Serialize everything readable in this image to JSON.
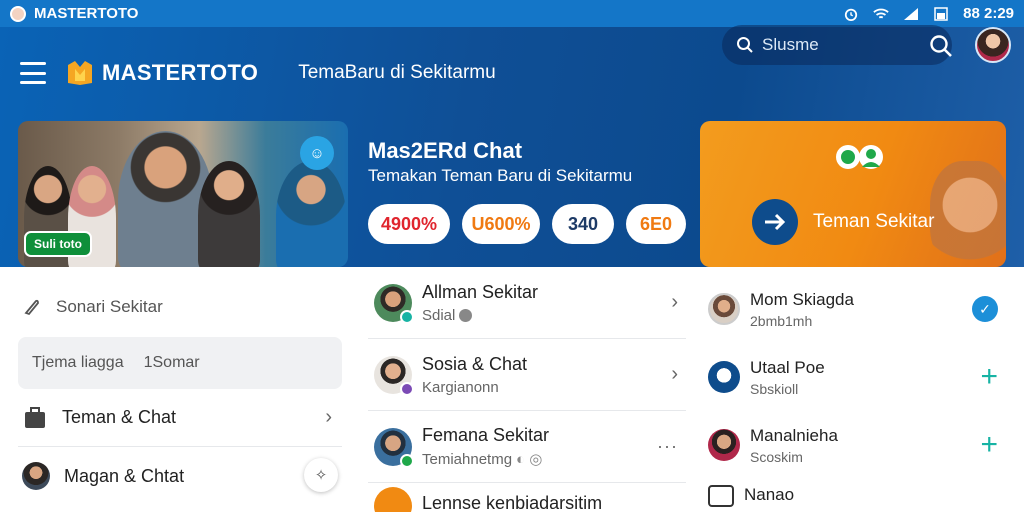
{
  "status_bar": {
    "app_name": "MASTERTOTO",
    "time": "88 2:29",
    "icons": [
      "alarm-icon",
      "wifi-icon",
      "signal-icon",
      "battery-icon"
    ]
  },
  "header": {
    "brand": "MASTERTOTO",
    "tagline": "TemaBaru di Sekitarmu",
    "search_placeholder": "Slusme"
  },
  "promo": {
    "photo_badge": "Suli toto",
    "title": "Mas2ERd Chat",
    "subtitle": "Temakan Teman Baru di Sekitarmu",
    "stats": [
      {
        "label": "4900%",
        "color": "#e0252e"
      },
      {
        "label": "U600%",
        "color": "#f07a12"
      },
      {
        "label": "340",
        "color": "#1d3a66"
      },
      {
        "label": "6E0",
        "color": "#f07a12"
      }
    ],
    "cta_label": "Teman Sekitar"
  },
  "left_panel": {
    "search_label": "Sonari Sekitar",
    "filter_left": "Tjema liagga",
    "filter_right": "1Somar",
    "items": [
      {
        "label": "Teman & Chat"
      },
      {
        "label": "Magan & Chtat"
      }
    ]
  },
  "chat_list": [
    {
      "name": "Allman Sekitar",
      "sub": "Sdial"
    },
    {
      "name": "Sosia & Chat",
      "sub": "Kargianonn"
    },
    {
      "name": "Femana Sekitar",
      "sub": "Temiahnetmg"
    },
    {
      "name": "Lennse kenbiadarsitim",
      "sub": ""
    }
  ],
  "contacts": [
    {
      "name": "Mom Skiagda",
      "sub": "2bmb1mh"
    },
    {
      "name": "Utaal Poe",
      "sub": "Sbskioll"
    },
    {
      "name": "Manalnieha",
      "sub": "Scoskim"
    },
    {
      "name": "Nanao",
      "sub": ""
    }
  ],
  "colors": {
    "primary_blue": "#1476c8",
    "accent_orange": "#f18a12",
    "accent_teal": "#17b3a4",
    "accent_red": "#e0252e"
  }
}
